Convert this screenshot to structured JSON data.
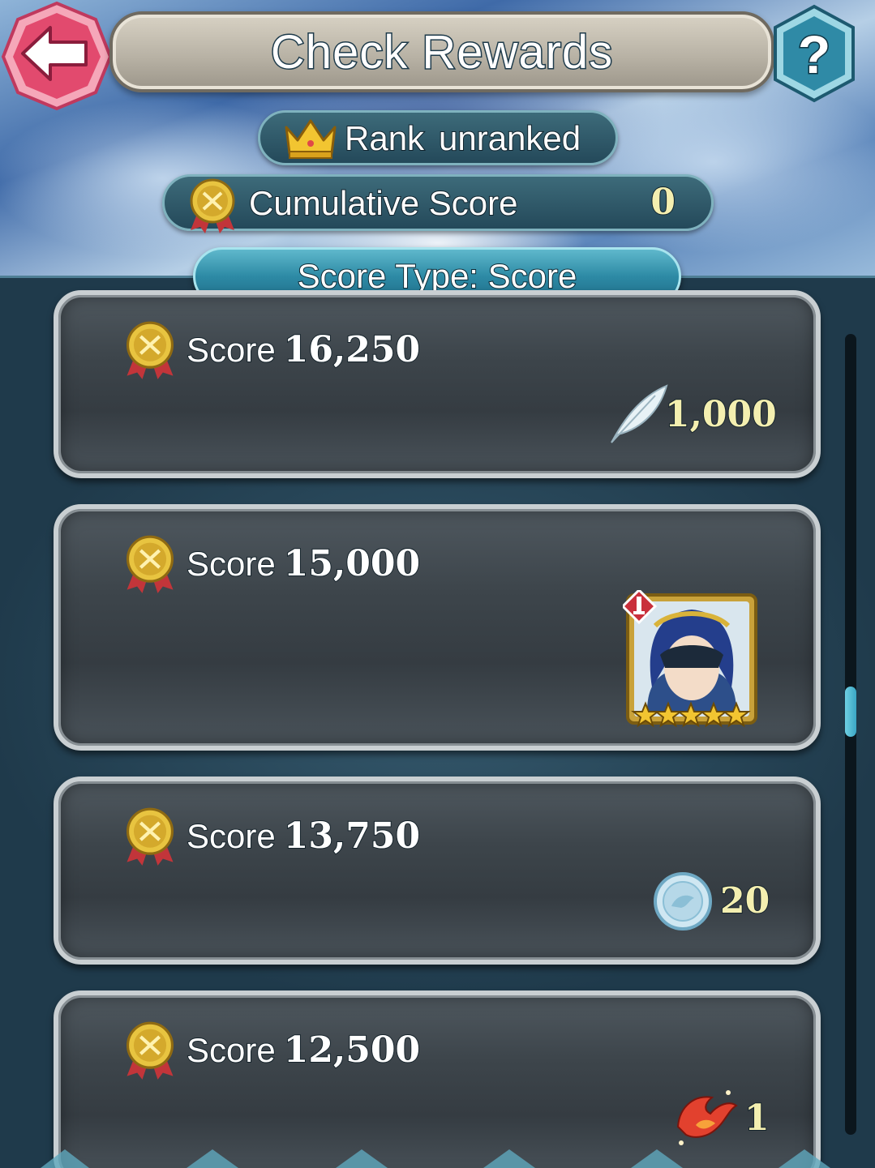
{
  "header": {
    "title": "Check Rewards"
  },
  "rank": {
    "label": "Rank",
    "value": "unranked"
  },
  "cumulative": {
    "label": "Cumulative Score",
    "value": "0"
  },
  "score_type": {
    "label": "Score Type: Score"
  },
  "rewards": [
    {
      "label": "Score",
      "score": "16,250",
      "reward_icon": "feather-icon",
      "amount": "1,000"
    },
    {
      "label": "Score",
      "score": "15,000",
      "reward_icon": "hero-portrait",
      "stars": 5
    },
    {
      "label": "Score",
      "score": "13,750",
      "reward_icon": "badge-coin-icon",
      "amount": "20"
    },
    {
      "label": "Score",
      "score": "12,500",
      "reward_icon": "phoenix-icon",
      "amount": "1"
    }
  ],
  "scroll": {
    "position_fraction": 0.47
  },
  "colors": {
    "accent_gold": "#f4efb0",
    "back_button": "#e8506e",
    "help_button": "#2f8aa6"
  }
}
